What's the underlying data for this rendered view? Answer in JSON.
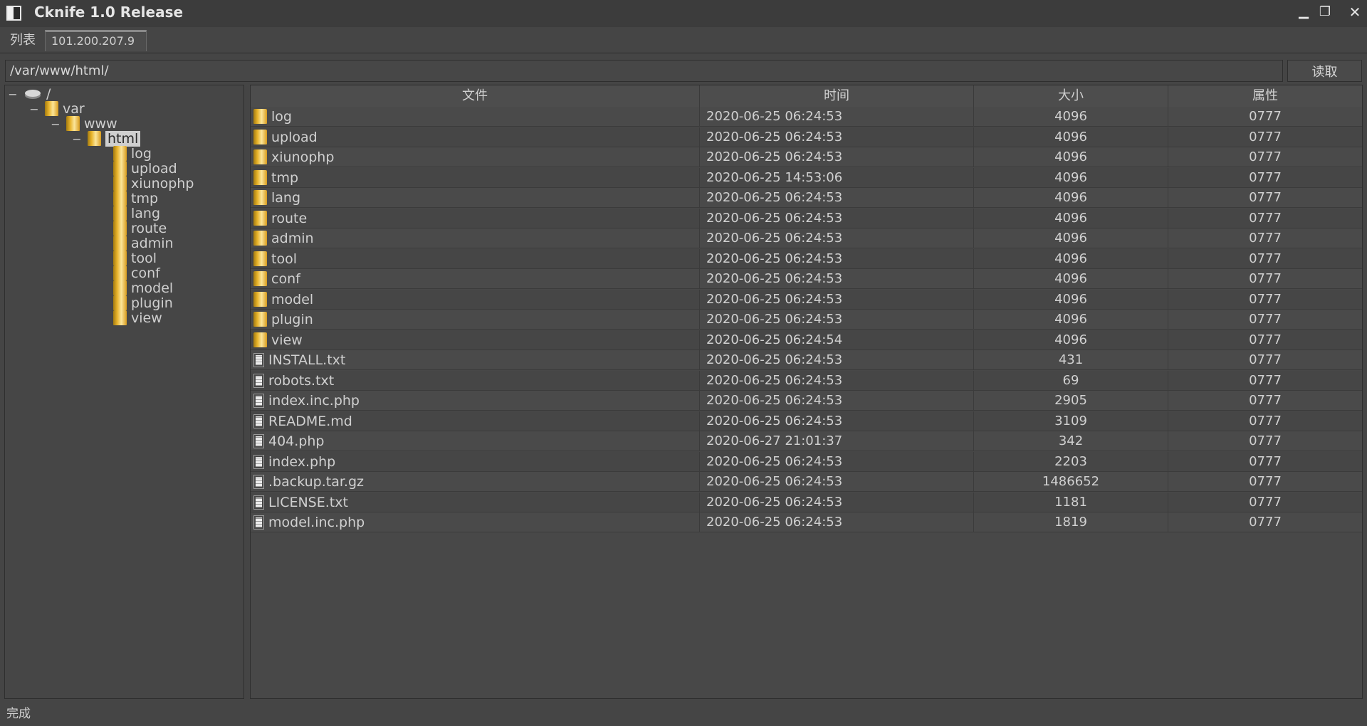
{
  "window": {
    "title": "Cknife 1.0 Release",
    "min_glyph": "▁",
    "max_glyph": "❐",
    "close_glyph": "✕"
  },
  "tabs": [
    {
      "label": "列表"
    },
    {
      "label": "101.200.207.9"
    }
  ],
  "pathbar": {
    "path": "/var/www/html/",
    "read_label": "读取"
  },
  "tree": {
    "root": "/",
    "var": "var",
    "www": "www",
    "html": "html",
    "children": [
      "log",
      "upload",
      "xiunophp",
      "tmp",
      "lang",
      "route",
      "admin",
      "tool",
      "conf",
      "model",
      "plugin",
      "view"
    ]
  },
  "table": {
    "headers": {
      "name": "文件",
      "time": "时间",
      "size": "大小",
      "attr": "属性"
    },
    "rows": [
      {
        "type": "folder",
        "name": "log",
        "time": "2020-06-25 06:24:53",
        "size": "4096",
        "attr": "0777"
      },
      {
        "type": "folder",
        "name": "upload",
        "time": "2020-06-25 06:24:53",
        "size": "4096",
        "attr": "0777"
      },
      {
        "type": "folder",
        "name": "xiunophp",
        "time": "2020-06-25 06:24:53",
        "size": "4096",
        "attr": "0777"
      },
      {
        "type": "folder",
        "name": "tmp",
        "time": "2020-06-25 14:53:06",
        "size": "4096",
        "attr": "0777"
      },
      {
        "type": "folder",
        "name": "lang",
        "time": "2020-06-25 06:24:53",
        "size": "4096",
        "attr": "0777"
      },
      {
        "type": "folder",
        "name": "route",
        "time": "2020-06-25 06:24:53",
        "size": "4096",
        "attr": "0777"
      },
      {
        "type": "folder",
        "name": "admin",
        "time": "2020-06-25 06:24:53",
        "size": "4096",
        "attr": "0777"
      },
      {
        "type": "folder",
        "name": "tool",
        "time": "2020-06-25 06:24:53",
        "size": "4096",
        "attr": "0777"
      },
      {
        "type": "folder",
        "name": "conf",
        "time": "2020-06-25 06:24:53",
        "size": "4096",
        "attr": "0777"
      },
      {
        "type": "folder",
        "name": "model",
        "time": "2020-06-25 06:24:53",
        "size": "4096",
        "attr": "0777"
      },
      {
        "type": "folder",
        "name": "plugin",
        "time": "2020-06-25 06:24:53",
        "size": "4096",
        "attr": "0777"
      },
      {
        "type": "folder",
        "name": "view",
        "time": "2020-06-25 06:24:54",
        "size": "4096",
        "attr": "0777"
      },
      {
        "type": "file",
        "name": "INSTALL.txt",
        "time": "2020-06-25 06:24:53",
        "size": "431",
        "attr": "0777"
      },
      {
        "type": "file",
        "name": "robots.txt",
        "time": "2020-06-25 06:24:53",
        "size": "69",
        "attr": "0777"
      },
      {
        "type": "file",
        "name": "index.inc.php",
        "time": "2020-06-25 06:24:53",
        "size": "2905",
        "attr": "0777"
      },
      {
        "type": "file",
        "name": "README.md",
        "time": "2020-06-25 06:24:53",
        "size": "3109",
        "attr": "0777"
      },
      {
        "type": "file",
        "name": "404.php",
        "time": "2020-06-27 21:01:37",
        "size": "342",
        "attr": "0777"
      },
      {
        "type": "file",
        "name": "index.php",
        "time": "2020-06-25 06:24:53",
        "size": "2203",
        "attr": "0777"
      },
      {
        "type": "file",
        "name": ".backup.tar.gz",
        "time": "2020-06-25 06:24:53",
        "size": "1486652",
        "attr": "0777"
      },
      {
        "type": "file",
        "name": "LICENSE.txt",
        "time": "2020-06-25 06:24:53",
        "size": "1181",
        "attr": "0777"
      },
      {
        "type": "file",
        "name": "model.inc.php",
        "time": "2020-06-25 06:24:53",
        "size": "1819",
        "attr": "0777"
      }
    ]
  },
  "status": {
    "text": "完成"
  }
}
